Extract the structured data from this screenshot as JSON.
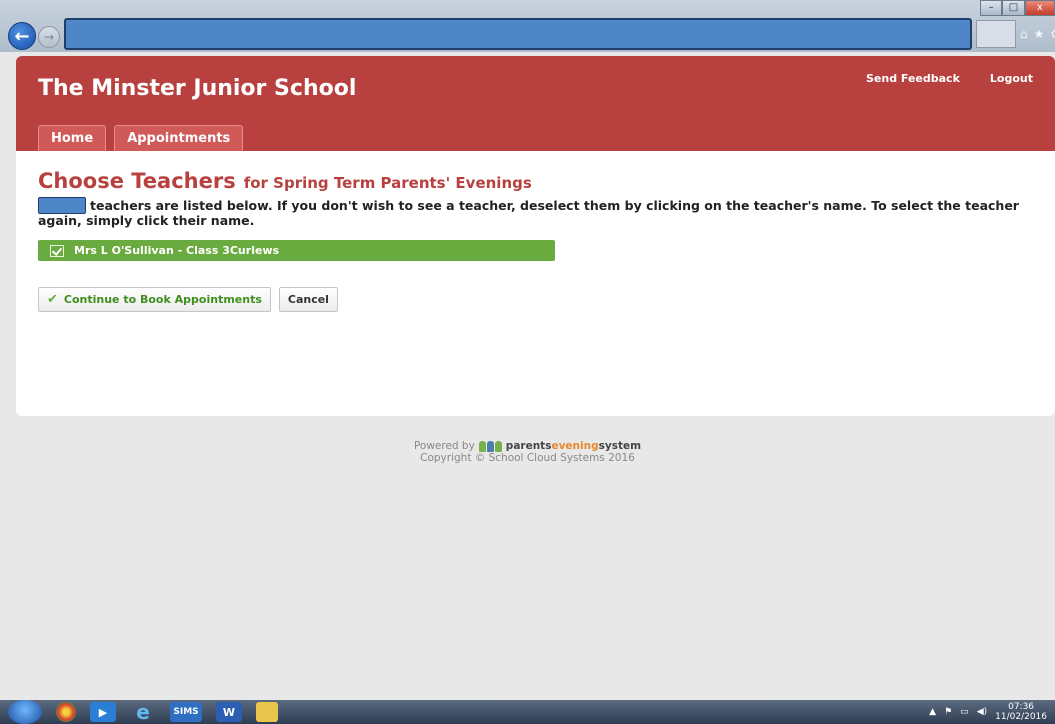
{
  "browser": {
    "window_buttons": [
      "–",
      "□",
      "x"
    ],
    "back_icon": "back-arrow-icon",
    "forward_icon": "forward-arrow-icon",
    "toolbar_icons": [
      "home-icon",
      "star-icon",
      "gear-icon"
    ]
  },
  "header": {
    "school_name": "The Minster Junior School",
    "links": [
      "Send Feedback",
      "Logout"
    ],
    "tabs": [
      "Home",
      "Appointments"
    ],
    "brand_color": "#b8413f"
  },
  "main": {
    "heading": "Choose Teachers",
    "subheading": "for Spring Term Parents' Evenings",
    "intro": "teachers are listed below. If you don't wish to see a teacher, deselect them by clicking on the teacher's name. To select the teacher again, simply click their name.",
    "teachers": [
      {
        "name": "Mrs L O'Sullivan - Class 3Curlews",
        "selected": true
      }
    ],
    "continue_button": "Continue to Book Appointments",
    "cancel_button": "Cancel"
  },
  "footer": {
    "powered_by": "Powered by",
    "brand_part1": "parents",
    "brand_part2": "evening",
    "brand_part3": "system",
    "copyright": "Copyright © School Cloud Systems 2016"
  },
  "taskbar": {
    "sims_label": "SIMS",
    "word_label": "W",
    "clock_time": "07:36",
    "clock_date": "11/02/2016"
  }
}
